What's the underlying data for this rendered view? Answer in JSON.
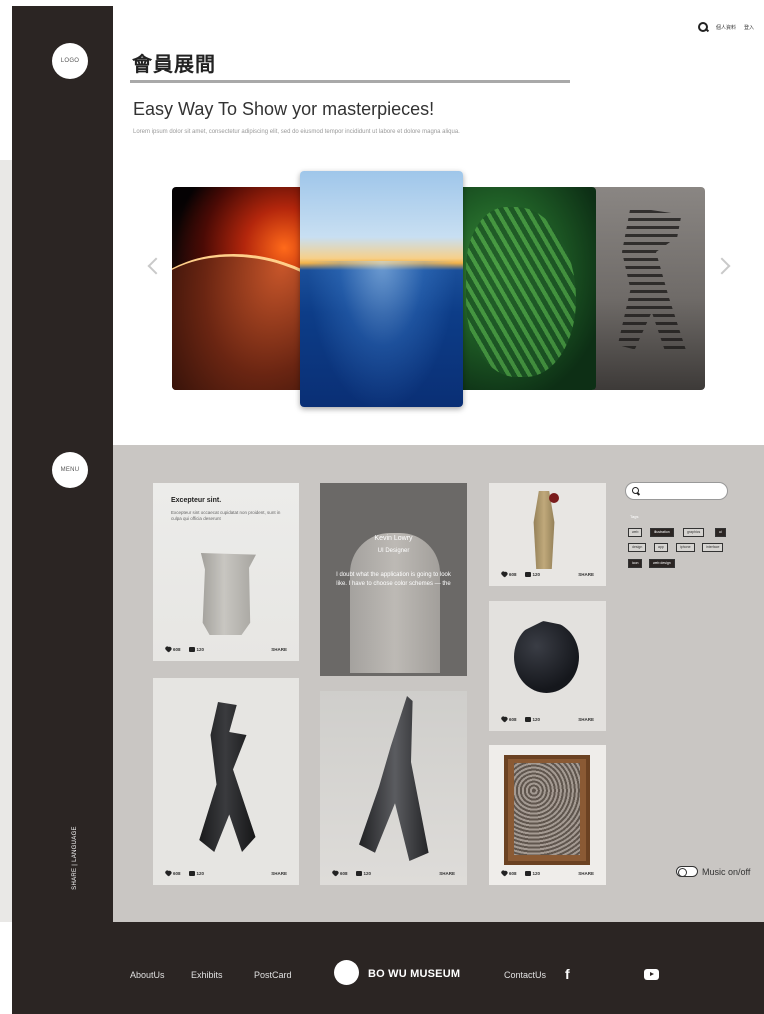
{
  "sidebar": {
    "logo_label": "LOGO",
    "menu_label": "MENU",
    "share_language": "SHARE | LANGUAGE"
  },
  "header": {
    "member_login": "個人資料",
    "login": "登入",
    "title": "會員展間",
    "tagline": "Easy Way To Show yor masterpieces!",
    "lorem": "Lorem ipsum dolor sit amet, consectetur adipiscing elit, sed do eiusmod tempor incididunt ut labore et dolore magna aliqua."
  },
  "carousel": {
    "slides": [
      "space-earth-image",
      "ocean-sunrise-image",
      "fern-image",
      "dinosaur-skeleton-image"
    ]
  },
  "gallery": {
    "card1": {
      "title": "Excepteur sint.",
      "text": "Excepteur sint occaecat cupidatat non proident, sunt in culpa qui officia deserunt"
    },
    "card2": {
      "name": "Kevin Lowry",
      "role": "UI Designer",
      "text": "I doubt what the application is going to look like. I have to choose color schemes — the"
    },
    "likes": "608",
    "comments": "120",
    "share": "SHARE"
  },
  "filter": {
    "tags_label": "Tags",
    "tags": [
      "web",
      "illustration",
      "graphics",
      "ui",
      "design",
      "app",
      "iphone",
      "interface",
      "icon",
      "web design"
    ]
  },
  "music": {
    "label": "Music on/off"
  },
  "footer": {
    "about": "AboutUs",
    "exhibits": "Exhibits",
    "postcard": "PostCard",
    "brand": "BO WU MUSEUM",
    "contact": "ContactUs",
    "facebook": "f"
  }
}
